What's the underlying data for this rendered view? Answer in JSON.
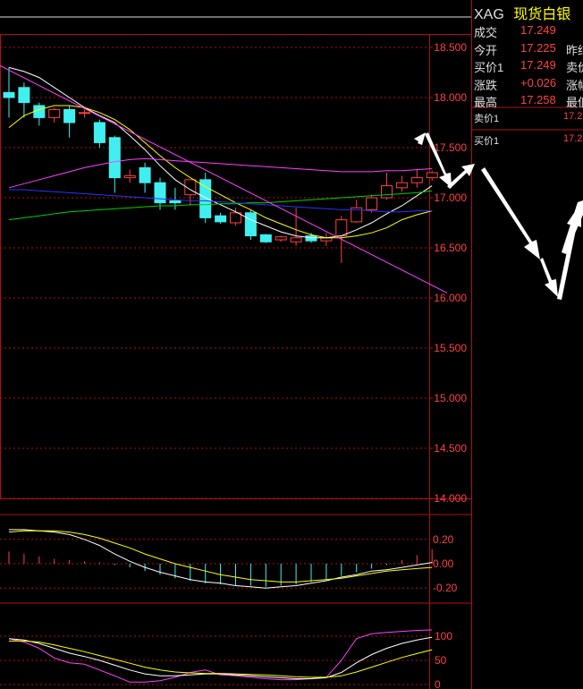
{
  "colors": {
    "background": "#000000",
    "frame": "#b01010",
    "up_candle": "#ff4040",
    "down_candle": "#40f0f0",
    "ma_white": "#ffffff",
    "ma_yellow": "#ffff00",
    "ma_magenta": "#ff40ff",
    "ma_green": "#00d000",
    "ma_blue": "#3030ff",
    "trend_magenta": "#ff40ff",
    "quote_red": "#ff4040",
    "quote_title_yellow": "#ffff00",
    "axis_text": "#ff4040"
  },
  "quote_panel": {
    "symbol": "XAG",
    "name": "现货白银",
    "rows": [
      {
        "label": "成交",
        "value": "17.249",
        "trail": ""
      },
      {
        "label": "今开",
        "value": "17.225",
        "trail": "昨结"
      },
      {
        "label": "买价1",
        "value": "17.249",
        "trail": "卖价"
      },
      {
        "label": "涨跌",
        "value": "+0.026",
        "trail": "涨幅"
      },
      {
        "label": "最高",
        "value": "17.258",
        "trail": "最低"
      }
    ],
    "sell1_label": "卖价1",
    "sell1_value": "17.2",
    "buy1_label": "买价1",
    "buy1_value": "17.2"
  },
  "chart_data": [
    {
      "type": "candlestick",
      "name": "price",
      "ylim": [
        14.0,
        18.75
      ],
      "yticks": [
        "18.500",
        "18.000",
        "17.500",
        "17.000",
        "16.500",
        "16.000",
        "15.500",
        "15.000",
        "14.500",
        "14.000"
      ],
      "grid": true,
      "candles": [
        {
          "o": 18.05,
          "h": 18.3,
          "c": 18.0,
          "l": 17.8
        },
        {
          "o": 18.1,
          "h": 18.15,
          "c": 17.95,
          "l": 17.8
        },
        {
          "o": 17.92,
          "h": 17.95,
          "c": 17.8,
          "l": 17.72
        },
        {
          "o": 17.8,
          "h": 17.9,
          "c": 17.88,
          "l": 17.75
        },
        {
          "o": 17.88,
          "h": 17.92,
          "c": 17.75,
          "l": 17.6
        },
        {
          "o": 17.85,
          "h": 17.88,
          "c": 17.85,
          "l": 17.8
        },
        {
          "o": 17.75,
          "h": 17.78,
          "c": 17.55,
          "l": 17.5
        },
        {
          "o": 17.6,
          "h": 17.62,
          "c": 17.2,
          "l": 17.05
        },
        {
          "o": 17.2,
          "h": 17.28,
          "c": 17.22,
          "l": 17.15
        },
        {
          "o": 17.3,
          "h": 17.35,
          "c": 17.15,
          "l": 17.05
        },
        {
          "o": 17.15,
          "h": 17.2,
          "c": 16.95,
          "l": 16.88
        },
        {
          "o": 16.97,
          "h": 17.1,
          "c": 16.95,
          "l": 16.88
        },
        {
          "o": 17.03,
          "h": 17.15,
          "c": 17.18,
          "l": 16.92
        },
        {
          "o": 17.18,
          "h": 17.25,
          "c": 16.8,
          "l": 16.75
        },
        {
          "o": 16.82,
          "h": 16.85,
          "c": 16.76,
          "l": 16.74
        },
        {
          "o": 16.75,
          "h": 16.9,
          "c": 16.85,
          "l": 16.72
        },
        {
          "o": 16.85,
          "h": 16.88,
          "c": 16.62,
          "l": 16.58
        },
        {
          "o": 16.63,
          "h": 16.64,
          "c": 16.56,
          "l": 16.55
        },
        {
          "o": 16.58,
          "h": 16.62,
          "c": 16.61,
          "l": 16.56
        },
        {
          "o": 16.56,
          "h": 16.9,
          "c": 16.6,
          "l": 16.52
        },
        {
          "o": 16.62,
          "h": 16.65,
          "c": 16.57,
          "l": 16.55
        },
        {
          "o": 16.57,
          "h": 16.65,
          "c": 16.6,
          "l": 16.52
        },
        {
          "o": 16.62,
          "h": 16.82,
          "c": 16.78,
          "l": 16.35
        },
        {
          "o": 16.76,
          "h": 16.98,
          "c": 16.9,
          "l": 16.75
        },
        {
          "o": 16.88,
          "h": 17.03,
          "c": 17.0,
          "l": 16.85
        },
        {
          "o": 17.0,
          "h": 17.25,
          "c": 17.12,
          "l": 16.98
        },
        {
          "o": 17.1,
          "h": 17.22,
          "c": 17.15,
          "l": 17.06
        },
        {
          "o": 17.15,
          "h": 17.28,
          "c": 17.2,
          "l": 17.1
        },
        {
          "o": 17.2,
          "h": 17.27,
          "c": 17.25,
          "l": 17.17
        }
      ],
      "ma_series": [
        {
          "color_key": "ma_white",
          "values": [
            18.3,
            18.26,
            18.2,
            18.1,
            18.0,
            17.9,
            17.82,
            17.75,
            17.62,
            17.48,
            17.32,
            17.18,
            17.08,
            17.0,
            16.93,
            16.86,
            16.78,
            16.72,
            16.66,
            16.62,
            16.6,
            16.6,
            16.62,
            16.68,
            16.75,
            16.84,
            16.92,
            17.02,
            17.12
          ]
        },
        {
          "color_key": "ma_yellow",
          "values": [
            17.7,
            17.82,
            17.88,
            17.92,
            17.92,
            17.9,
            17.85,
            17.78,
            17.68,
            17.55,
            17.42,
            17.3,
            17.2,
            17.11,
            17.03,
            16.95,
            16.88,
            16.8,
            16.74,
            16.68,
            16.63,
            16.6,
            16.6,
            16.62,
            16.65,
            16.7,
            16.78,
            16.83,
            16.87
          ]
        },
        {
          "color_key": "ma_magenta",
          "values": [
            17.1,
            17.14,
            17.18,
            17.22,
            17.26,
            17.3,
            17.33,
            17.36,
            17.38,
            17.39,
            17.38,
            17.37,
            17.36,
            17.35,
            17.34,
            17.33,
            17.32,
            17.31,
            17.3,
            17.29,
            17.28,
            17.27,
            17.26,
            17.26,
            17.26,
            17.27,
            17.27,
            17.28,
            17.29
          ]
        },
        {
          "color_key": "ma_green",
          "values": [
            16.78,
            16.8,
            16.82,
            16.84,
            16.86,
            16.87,
            16.88,
            16.89,
            16.9,
            16.91,
            16.92,
            16.92,
            16.93,
            16.93,
            16.94,
            16.94,
            16.95,
            16.95,
            16.96,
            16.97,
            16.98,
            16.99,
            17.0,
            17.01,
            17.02,
            17.03,
            17.04,
            17.05,
            17.07
          ]
        },
        {
          "color_key": "ma_blue",
          "values": [
            17.08,
            17.08,
            17.07,
            17.06,
            17.05,
            17.04,
            17.03,
            17.02,
            17.01,
            17.0,
            16.99,
            16.98,
            16.97,
            16.97,
            16.96,
            16.95,
            16.94,
            16.93,
            16.92,
            16.91,
            16.9,
            16.89,
            16.88,
            16.88,
            16.87,
            16.86,
            16.86,
            16.87,
            16.87
          ]
        }
      ],
      "trendline": {
        "from": {
          "index": -1,
          "value": 18.35
        },
        "to": {
          "index": 29,
          "value": 16.05
        }
      }
    },
    {
      "type": "bar",
      "name": "macd",
      "ylim": [
        -0.3,
        0.3
      ],
      "yticks": [
        "0.20",
        "0.00",
        "-0.20"
      ],
      "histogram": [
        0.1,
        0.08,
        0.06,
        0.04,
        0.03,
        0.02,
        0.01,
        -0.01,
        -0.03,
        -0.06,
        -0.09,
        -0.12,
        -0.14,
        -0.16,
        -0.17,
        -0.18,
        -0.18,
        -0.19,
        -0.18,
        -0.17,
        -0.15,
        -0.13,
        -0.1,
        -0.07,
        -0.04,
        -0.01,
        0.03,
        0.07,
        0.12
      ],
      "lines": [
        {
          "color_key": "ma_white",
          "values": [
            0.28,
            0.28,
            0.27,
            0.26,
            0.24,
            0.2,
            0.15,
            0.08,
            0.02,
            -0.03,
            -0.07,
            -0.1,
            -0.13,
            -0.15,
            -0.16,
            -0.18,
            -0.19,
            -0.2,
            -0.19,
            -0.18,
            -0.16,
            -0.14,
            -0.11,
            -0.09,
            -0.06,
            -0.05,
            -0.03,
            -0.01,
            0.01
          ]
        },
        {
          "color_key": "ma_yellow",
          "values": [
            0.26,
            0.27,
            0.27,
            0.27,
            0.26,
            0.24,
            0.21,
            0.17,
            0.13,
            0.08,
            0.04,
            0.0,
            -0.03,
            -0.06,
            -0.09,
            -0.11,
            -0.13,
            -0.14,
            -0.15,
            -0.15,
            -0.14,
            -0.13,
            -0.12,
            -0.1,
            -0.08,
            -0.06,
            -0.05,
            -0.04,
            -0.03
          ]
        }
      ]
    },
    {
      "type": "line",
      "name": "kdj",
      "ylim": [
        0,
        115
      ],
      "yticks": [
        "100",
        "50",
        "0"
      ],
      "lines": [
        {
          "color_key": "ma_magenta",
          "values": [
            95,
            88,
            75,
            55,
            45,
            42,
            30,
            18,
            5,
            5,
            8,
            15,
            25,
            30,
            20,
            18,
            15,
            12,
            10,
            10,
            12,
            15,
            50,
            95,
            105,
            108,
            110,
            112,
            113
          ]
        },
        {
          "color_key": "ma_white",
          "values": [
            95,
            92,
            85,
            75,
            65,
            58,
            50,
            40,
            30,
            22,
            18,
            18,
            20,
            22,
            22,
            20,
            18,
            16,
            14,
            12,
            12,
            14,
            25,
            45,
            62,
            75,
            85,
            92,
            98
          ]
        },
        {
          "color_key": "ma_yellow",
          "values": [
            90,
            90,
            88,
            82,
            75,
            68,
            60,
            52,
            44,
            36,
            30,
            26,
            24,
            23,
            23,
            22,
            21,
            20,
            18,
            16,
            15,
            15,
            18,
            26,
            36,
            46,
            56,
            64,
            72
          ]
        }
      ]
    }
  ]
}
